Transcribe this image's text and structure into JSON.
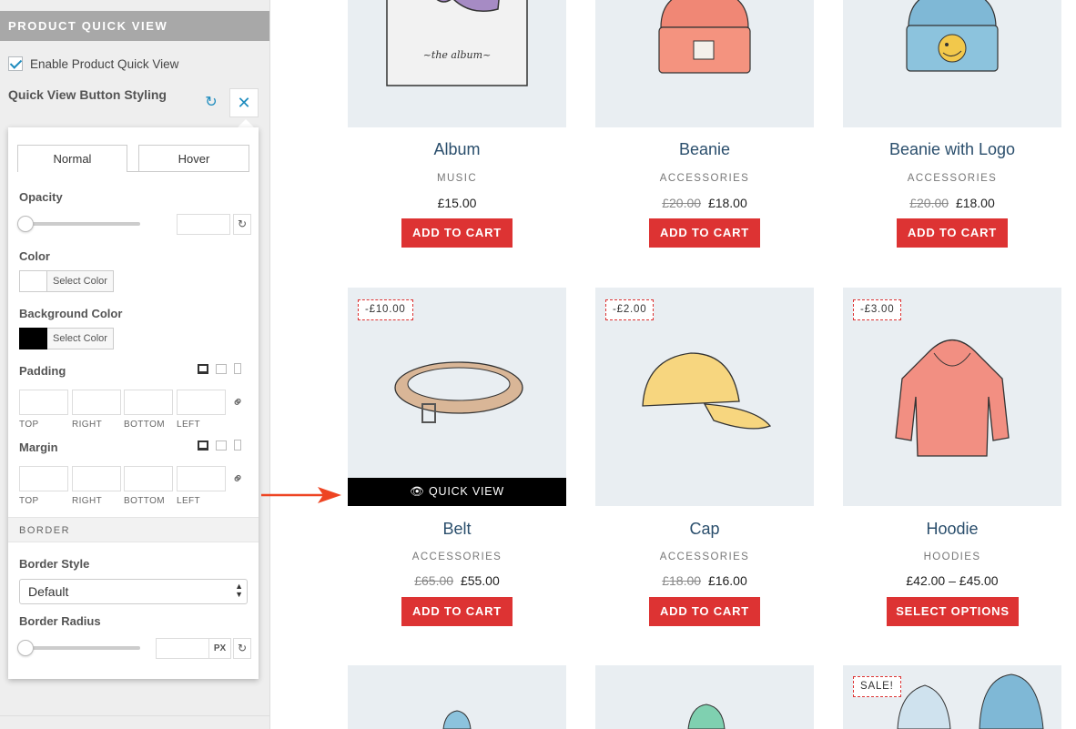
{
  "sidebar": {
    "section_title": "PRODUCT QUICK VIEW",
    "enable_label": "Enable Product Quick View",
    "styling_title": "Quick View Button Styling",
    "tabs": [
      "Normal",
      "Hover"
    ],
    "opacity_label": "Opacity",
    "color_label": "Color",
    "select_color": "Select Color",
    "bg_color_label": "Background Color",
    "padding_label": "Padding",
    "margin_label": "Margin",
    "quad_labels": [
      "TOP",
      "RIGHT",
      "BOTTOM",
      "LEFT"
    ],
    "border_head": "BORDER",
    "border_style_label": "Border Style",
    "border_style_value": "Default",
    "border_radius_label": "Border Radius",
    "px_unit": "PX",
    "colors": {
      "color_swatch": "#ffffff",
      "bg_swatch": "#000000"
    }
  },
  "products": [
    {
      "name": "Album",
      "category": "MUSIC",
      "price": "£15.00",
      "old_price": "",
      "button": "ADD TO CART"
    },
    {
      "name": "Beanie",
      "category": "ACCESSORIES",
      "price": "£18.00",
      "old_price": "£20.00",
      "button": "ADD TO CART"
    },
    {
      "name": "Beanie with Logo",
      "category": "ACCESSORIES",
      "price": "£18.00",
      "old_price": "£20.00",
      "button": "ADD TO CART"
    },
    {
      "name": "Belt",
      "category": "ACCESSORIES",
      "price": "£55.00",
      "old_price": "£65.00",
      "button": "ADD TO CART",
      "badge": "-£10.00"
    },
    {
      "name": "Cap",
      "category": "ACCESSORIES",
      "price": "£16.00",
      "old_price": "£18.00",
      "button": "ADD TO CART",
      "badge": "-£2.00"
    },
    {
      "name": "Hoodie",
      "category": "HOODIES",
      "price": "£42.00 – £45.00",
      "old_price": "",
      "button": "SELECT OPTIONS",
      "badge": "-£3.00"
    },
    {
      "badge": "SALE!"
    }
  ],
  "quick_view_label": "QUICK VIEW",
  "accent": "#dd3333"
}
